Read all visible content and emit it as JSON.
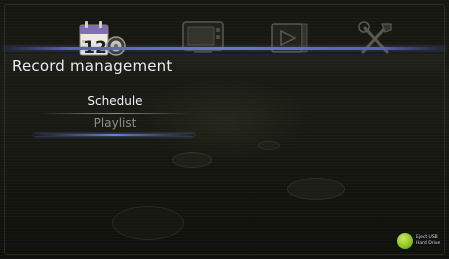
{
  "topbar": {
    "icons": [
      {
        "name": "calendar-record-icon",
        "day": "12",
        "active": true
      },
      {
        "name": "tv-icon",
        "active": false
      },
      {
        "name": "film-icon",
        "active": false
      },
      {
        "name": "tools-icon",
        "active": false
      }
    ],
    "calendar_day": "12"
  },
  "header": {
    "title": "Record management"
  },
  "menu": {
    "items": [
      {
        "label": "Schedule",
        "selected": false
      },
      {
        "label": "Playlist",
        "selected": true
      }
    ]
  },
  "status": {
    "usb_line1": "Eject USB",
    "usb_line2": "Hard Drive",
    "usb_color": "#8cc21d"
  },
  "colors": {
    "accent_divider": "#6a78c8",
    "background": "#15160f",
    "title_text": "#ececec"
  }
}
